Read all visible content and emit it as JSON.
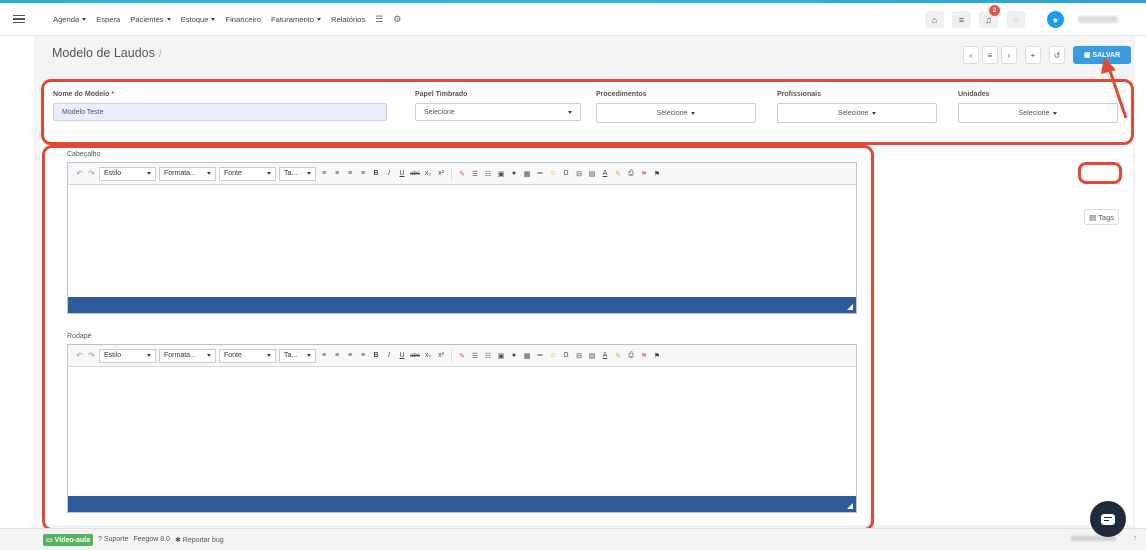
{
  "nav": {
    "items": [
      {
        "label": "Agenda",
        "dropdown": true
      },
      {
        "label": "Espera",
        "dropdown": false
      },
      {
        "label": "Pacientes",
        "dropdown": true
      },
      {
        "label": "Estoque",
        "dropdown": true
      },
      {
        "label": "Financeiro",
        "dropdown": false
      },
      {
        "label": "Faturamento",
        "dropdown": true
      },
      {
        "label": "Relatórios",
        "dropdown": false
      }
    ],
    "notification_count": "2"
  },
  "page": {
    "title": "Modelo de Laudos",
    "separator": "/",
    "save_label": "SALVAR"
  },
  "form": {
    "nome_label": "Nome do Modelo",
    "nome_required": "*",
    "nome_value": "Modelo Teste",
    "papel_label": "Papel Timbrado",
    "papel_value": "Selecione",
    "procedimentos_label": "Procedimentos",
    "procedimentos_value": "Selecione",
    "profissionais_label": "Profissionais",
    "profissionais_value": "Selecione",
    "unidades_label": "Unidades",
    "unidades_value": "Selecione"
  },
  "editors": {
    "cabecalho_label": "Cabeçalho",
    "rodape_label": "Rodapé",
    "toolbar": {
      "estilo": "Estilo",
      "formata": "Formata...",
      "fonte": "Fonte",
      "tamanho": "Ta..."
    }
  },
  "tags_label": "Tags",
  "footer": {
    "video": "Vídeo-aula",
    "suporte": "Suporte",
    "version": "Feegow 8.0",
    "reportar": "Reportar bug"
  },
  "colors": {
    "accent": "#3b9be0",
    "highlight": "#e04a35",
    "editor_footer": "#2f5b9a"
  }
}
